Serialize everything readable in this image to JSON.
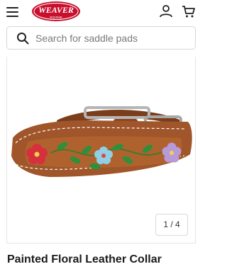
{
  "header": {
    "logo_text": "WEAVER",
    "logo_subtext": "EQUINE",
    "menu_icon": "hamburger-menu-icon",
    "account_icon": "account-icon",
    "cart_icon": "cart-icon"
  },
  "search": {
    "placeholder": "Search for saddle pads",
    "value": ""
  },
  "gallery": {
    "counter": "1 / 4"
  },
  "product": {
    "title": "Painted Floral Leather Collar"
  },
  "colors": {
    "brand_red": "#c8102e",
    "leather": "#a0552a",
    "text_dark": "#1b1b1b"
  }
}
